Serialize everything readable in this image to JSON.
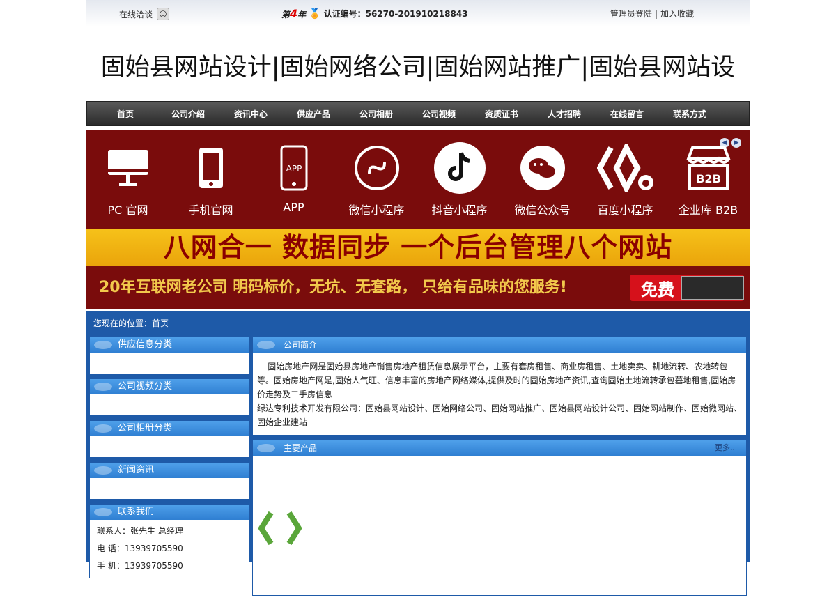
{
  "topbar": {
    "chat_label": "在线洽谈",
    "year_prefix": "第",
    "year_number": "4",
    "year_suffix": "年",
    "cert_label": "认证编号：56270-201910218843",
    "admin_login": "管理员登陆",
    "separator": "|",
    "add_favorite": "加入收藏"
  },
  "site_title": "固始县网站设计|固始网络公司|固始网站推广|固始县网站设",
  "nav": [
    "首页",
    "公司介绍",
    "资讯中心",
    "供应产品",
    "公司相册",
    "公司视频",
    "资质证书",
    "人才招聘",
    "在线留言",
    "联系方式"
  ],
  "banner": {
    "items": [
      {
        "label": "PC 官网",
        "icon": "desktop-icon"
      },
      {
        "label": "手机官网",
        "icon": "mobile-icon"
      },
      {
        "label": "APP",
        "icon": "app-icon"
      },
      {
        "label": "微信小程序",
        "icon": "wechat-miniprogram-icon"
      },
      {
        "label": "抖音小程序",
        "icon": "douyin-icon"
      },
      {
        "label": "微信公众号",
        "icon": "wechat-icon"
      },
      {
        "label": "百度小程序",
        "icon": "baidu-icon"
      },
      {
        "label": "企业库 B2B",
        "icon": "b2b-shop-icon"
      }
    ],
    "app_glyph_text": "APP",
    "b2b_glyph_text": "B2B",
    "headline": "八网合一  数据同步  一个后台管理八个网站",
    "slogan": "20年互联网老公司  明码标价，无坑、无套路， 只给有品味的您服务!",
    "free_label": "免费",
    "colors": {
      "banner_bg": "#7a0c0c",
      "yellow": "#f6c21a",
      "headline_text": "#8a0000",
      "slogan_text": "#f2c94c"
    }
  },
  "breadcrumb": "您现在的位置：首页",
  "sidebar": {
    "supply_title": "供应信息分类",
    "video_title": "公司视频分类",
    "album_title": "公司相册分类",
    "news_title": "新闻资讯",
    "contact_title": "联系我们",
    "contact_person": "联系人：张先生 总经理",
    "phone": "电  话：13939705590",
    "mobile": "手  机：13939705590"
  },
  "main": {
    "intro_title": "公司简介",
    "intro_line1": "    固始房地产网是固始县房地产销售房地产租赁信息展示平台，主要有套房租售、商业房租售、土地卖卖、耕地流转、农地转包等。固始房地产网是,固始人气旺、信息丰富的房地产网络媒体,提供及时的固始房地产资讯,查询固始土地流转承包墓地租售,固始房价走势及二手房信息",
    "intro_line2": "绿达专利技术开发有限公司：固始县网站设计、固始网络公司、固始网站推广、固始县网站设计公司、固始网站制作、固始微网站、固始企业建站",
    "products_title": "主要产品",
    "more": "更多.."
  }
}
